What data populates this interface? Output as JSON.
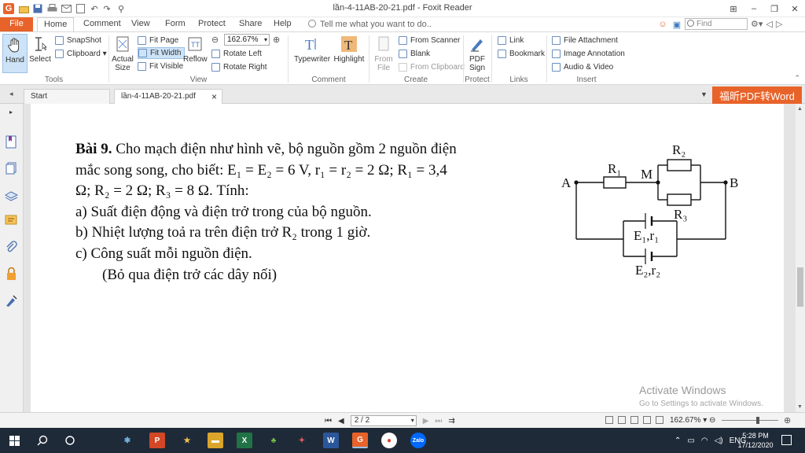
{
  "window": {
    "title": "lần-4-11AB-20-21.pdf - Foxit Reader",
    "app_logo": "G",
    "controls": [
      "⊞",
      "–",
      "❐",
      "✕"
    ]
  },
  "ribbon_tabs": [
    "File",
    "Home",
    "Comment",
    "View",
    "Form",
    "Protect",
    "Share",
    "Help"
  ],
  "tell_me": "Tell me what you want to do..",
  "find_placeholder": "Find",
  "ribbon": {
    "tools": {
      "hand": "Hand",
      "select": "Select",
      "snapshot": "SnapShot",
      "clipboard": "Clipboard ▾",
      "label": "Tools"
    },
    "view": {
      "actual_size": "Actual Size",
      "fit_page": "Fit Page",
      "fit_width": "Fit Width",
      "fit_visible": "Fit Visible",
      "reflow": "Reflow",
      "zoom": "162.67%",
      "rotate_left": "Rotate Left",
      "rotate_right": "Rotate Right",
      "label": "View"
    },
    "comment": {
      "typewriter": "Typewriter",
      "highlight": "Highlight",
      "label": "Comment"
    },
    "create": {
      "from_file": "From File",
      "from_scanner": "From Scanner",
      "blank": "Blank",
      "from_clipboard": "From Clipboard",
      "label": "Create"
    },
    "protect": {
      "pdf_sign": "PDF Sign",
      "label": "Protect"
    },
    "links": {
      "link": "Link",
      "bookmark": "Bookmark",
      "label": "Links"
    },
    "insert": {
      "file_attachment": "File Attachment",
      "image_annotation": "Image Annotation",
      "audio_video": "Audio & Video",
      "label": "Insert"
    }
  },
  "doc_tabs": {
    "start": "Start",
    "file": "lần-4-11AB-20-21.pdf",
    "close": "×"
  },
  "promo": "福昕PDF转Word",
  "problem": {
    "heading": "Bài 9.",
    "line1": " Cho mạch điện như hình vẽ, bộ nguồn gồm 2 nguồn điện",
    "line2": "mắc song song, cho biết: E₁ = E₂ = 6 V, r₁ = r₂ = 2 Ω;  R₁ = 3,4",
    "line3": "Ω; R₂ = 2 Ω; R₃ = 8 Ω. Tính:",
    "qa": "a) Suất điện động và điện trở trong của bộ nguồn.",
    "qb": "b) Nhiệt lượng toả ra trên điện trở R₂ trong 1 giờ.",
    "qc": "c) Công suất mỗi nguồn điện.",
    "note": "(Bỏ qua điện trở các dây nối)"
  },
  "circuit": {
    "A": "A",
    "B": "B",
    "M": "M",
    "R1": "R₁",
    "R2": "R₂",
    "R3": "R₃",
    "E1": "E₁,r₁",
    "E2": "E₂,r₂"
  },
  "watermark": {
    "title": "Activate Windows",
    "subtitle": "Go to Settings to activate Windows."
  },
  "status": {
    "page": "2 / 2",
    "zoom": "162.67%"
  },
  "taskbar": {
    "tray_lang": "ENG",
    "time": "5:28 PM",
    "date": "17/12/2020"
  },
  "colors": {
    "accent": "#e8632a",
    "taskbar": "#1f2a38",
    "active_tool": "#cde3f7"
  }
}
